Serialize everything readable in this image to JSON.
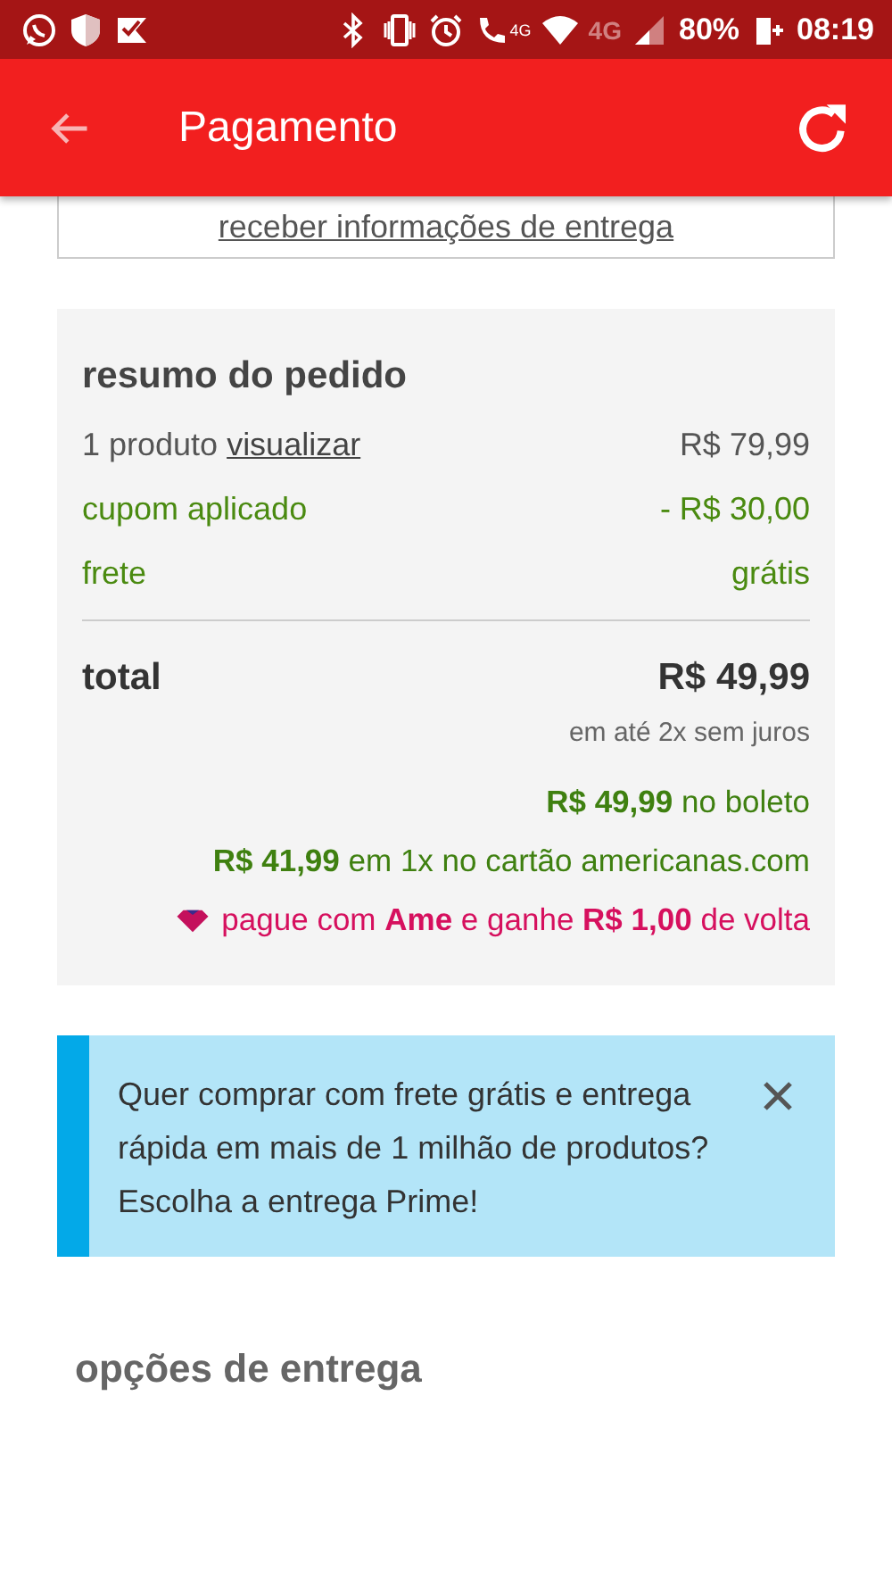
{
  "status_bar": {
    "network_badge": "4G",
    "network": "4G",
    "battery": "80%",
    "time": "08:19"
  },
  "app_bar": {
    "title": "Pagamento"
  },
  "delivery_card": {
    "link": "receber informações de entrega"
  },
  "summary": {
    "title": "resumo do pedido",
    "lines": [
      {
        "label": "1 produto",
        "link": "visualizar",
        "value": "R$ 79,99",
        "kind": "normal"
      },
      {
        "label": "cupom aplicado",
        "value": "- R$ 30,00",
        "kind": "discount"
      },
      {
        "label": "frete",
        "value": "grátis",
        "kind": "discount"
      }
    ],
    "total_label": "total",
    "total_value": "R$ 49,99",
    "installments": "em até 2x sem juros",
    "offers": [
      {
        "text": "**R$ 49,99** no boleto",
        "kind": "offer"
      },
      {
        "text": "**R$ 41,99** em 1x no cartão americanas.com",
        "kind": "offer"
      },
      {
        "text": "pague com **Ame** e ganhe **R$ 1,00** de volta",
        "kind": "cashback"
      }
    ]
  },
  "banner": {
    "text": "Quer comprar com frete grátis e entrega rápida em mais de 1 milhão de produtos? Escolha a entrega Prime!"
  },
  "section_title": "opções de entrega"
}
